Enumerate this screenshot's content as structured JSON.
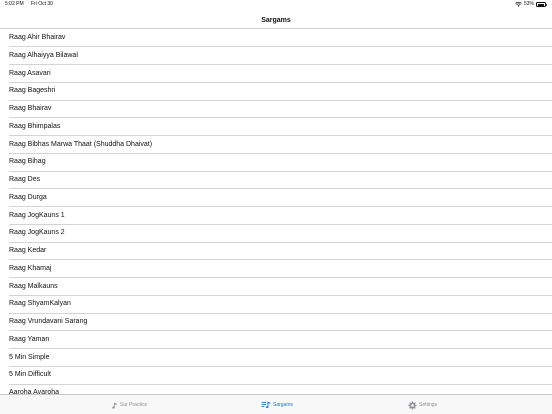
{
  "status_bar": {
    "time": "5:02 PM",
    "date": "Fri Oct 30",
    "battery": "53%"
  },
  "nav": {
    "title": "Sargams"
  },
  "list": {
    "items": [
      "Raag Ahir Bhairav",
      "Raag Alhaiyya Bilawal",
      "Raag Asavari",
      "Raag Bageshri",
      "Raag Bhairav",
      "Raag Bhimpalas",
      "Raag Bibhas Marwa Thaat (Shuddha Dhaivat)",
      "Raag Bihag",
      "Raag Des",
      "Raag Durga",
      "Raag JogKauns 1",
      "Raag JogKauns 2",
      "Raag Kedar",
      "Raag Khamaj",
      "Raag Malkauns",
      "Raag ShyamKalyan",
      "Raag Vrundavani Sarang",
      "Raag Yaman",
      "5 Min Simple",
      "5 Min Difficult",
      "Aaroha Avaroha"
    ]
  },
  "tab_bar": {
    "tabs": [
      {
        "label": "Sur Practice",
        "icon": "music-note-icon",
        "active": false
      },
      {
        "label": "Sargams",
        "icon": "music-list-icon",
        "active": true
      },
      {
        "label": "Settings",
        "icon": "gear-icon",
        "active": false
      }
    ],
    "active_color": "#1a73e8",
    "inactive_color": "#8e8e93"
  }
}
